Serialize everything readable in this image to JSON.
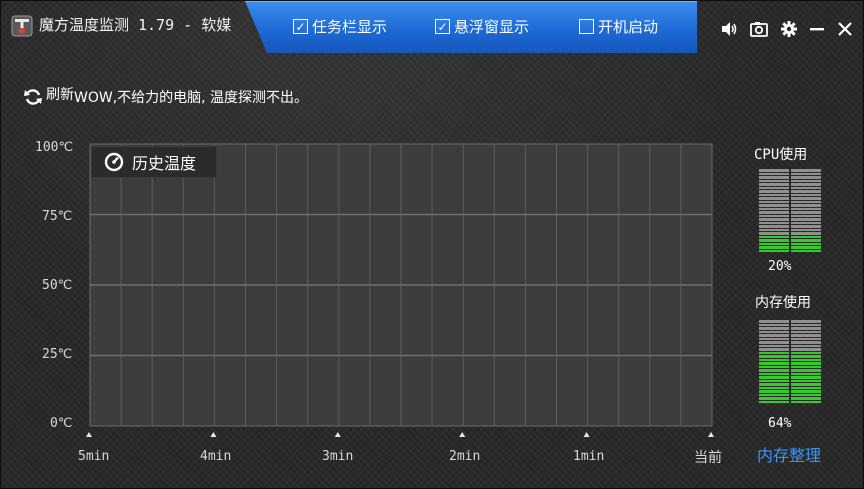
{
  "titlebar": {
    "title": "魔方温度监测 1.79 - 软媒",
    "options": [
      {
        "label": "任务栏显示",
        "checked": true
      },
      {
        "label": "悬浮窗显示",
        "checked": true
      },
      {
        "label": "开机启动",
        "checked": false
      }
    ],
    "controls": [
      "sound-icon",
      "camera-icon",
      "gear-icon",
      "minimize-icon",
      "close-icon"
    ]
  },
  "toolbar": {
    "refresh_label": "刷新",
    "status_message": "WOW,不给力的电脑, 温度探测不出。"
  },
  "chart_data": {
    "type": "line",
    "title": "历史温度",
    "y_ticks": [
      "100℃",
      "75℃",
      "50℃",
      "25℃",
      "0℃"
    ],
    "x_ticks": [
      "5min",
      "4min",
      "3min",
      "2min",
      "1min",
      "当前"
    ],
    "ylim": [
      0,
      100
    ],
    "grid": true,
    "series": []
  },
  "usage": {
    "cpu": {
      "title": "CPU使用",
      "percent": 20,
      "percent_label": "20%"
    },
    "memory": {
      "title": "内存使用",
      "percent": 64,
      "percent_label": "64%"
    },
    "clean_label": "内存整理"
  },
  "colors": {
    "accent_blue": "#1e6ad6",
    "meter_on": "#38c72e",
    "meter_off": "#8f8f8f",
    "link_blue": "#3b96f2"
  }
}
